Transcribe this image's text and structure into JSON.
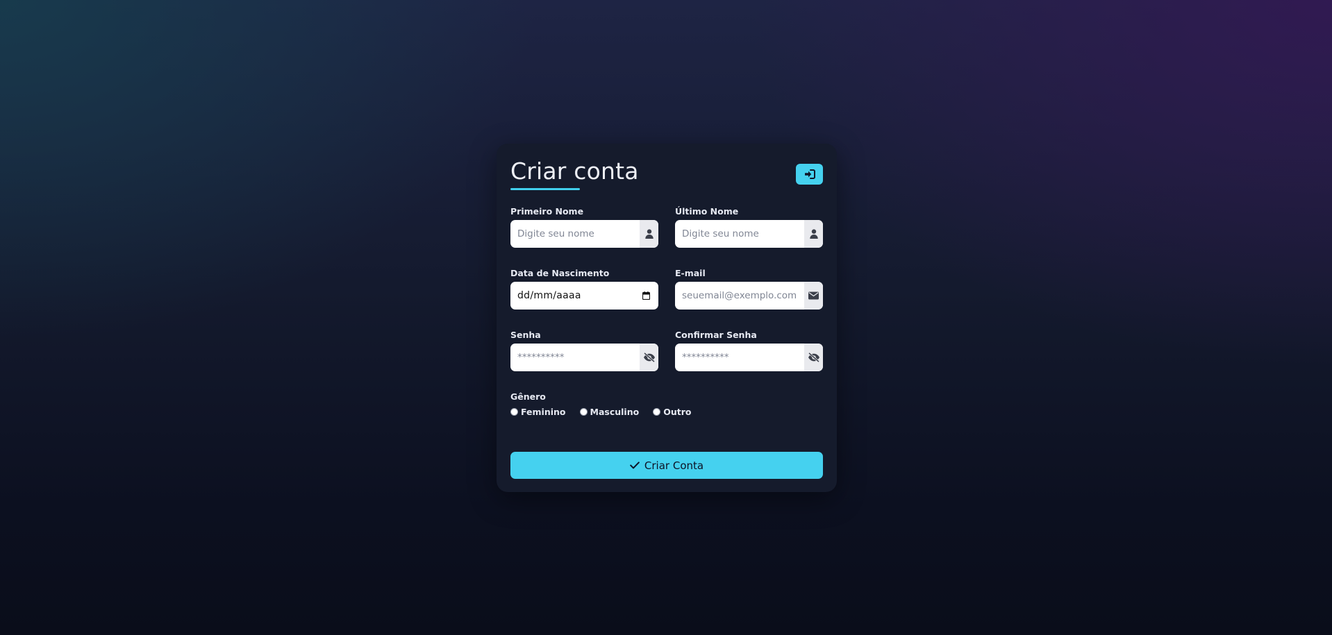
{
  "form": {
    "title": "Criar conta",
    "login_icon": "sign-in-icon",
    "fields": {
      "first_name": {
        "label": "Primeiro Nome",
        "placeholder": "Digite seu nome",
        "icon": "user-icon"
      },
      "last_name": {
        "label": "Último Nome",
        "placeholder": "Digite seu nome",
        "icon": "user-icon"
      },
      "birth_date": {
        "label": "Data de Nascimento",
        "value": "dd/mm/aaaa",
        "icon": "calendar-icon"
      },
      "email": {
        "label": "E-mail",
        "placeholder": "seuemail@exemplo.com",
        "icon": "envelope-icon"
      },
      "password": {
        "label": "Senha",
        "placeholder": "**********",
        "icon": "eye-slash-icon"
      },
      "confirm_password": {
        "label": "Confirmar Senha",
        "placeholder": "**********",
        "icon": "eye-slash-icon"
      }
    },
    "gender": {
      "label": "Gênero",
      "options": [
        "Feminino",
        "Masculino",
        "Outro"
      ]
    },
    "submit_label": "Criar Conta",
    "submit_icon": "check-icon"
  },
  "colors": {
    "accent": "#45d1ef",
    "card_background": "#151b2c",
    "text_light": "#e6e9f2"
  }
}
